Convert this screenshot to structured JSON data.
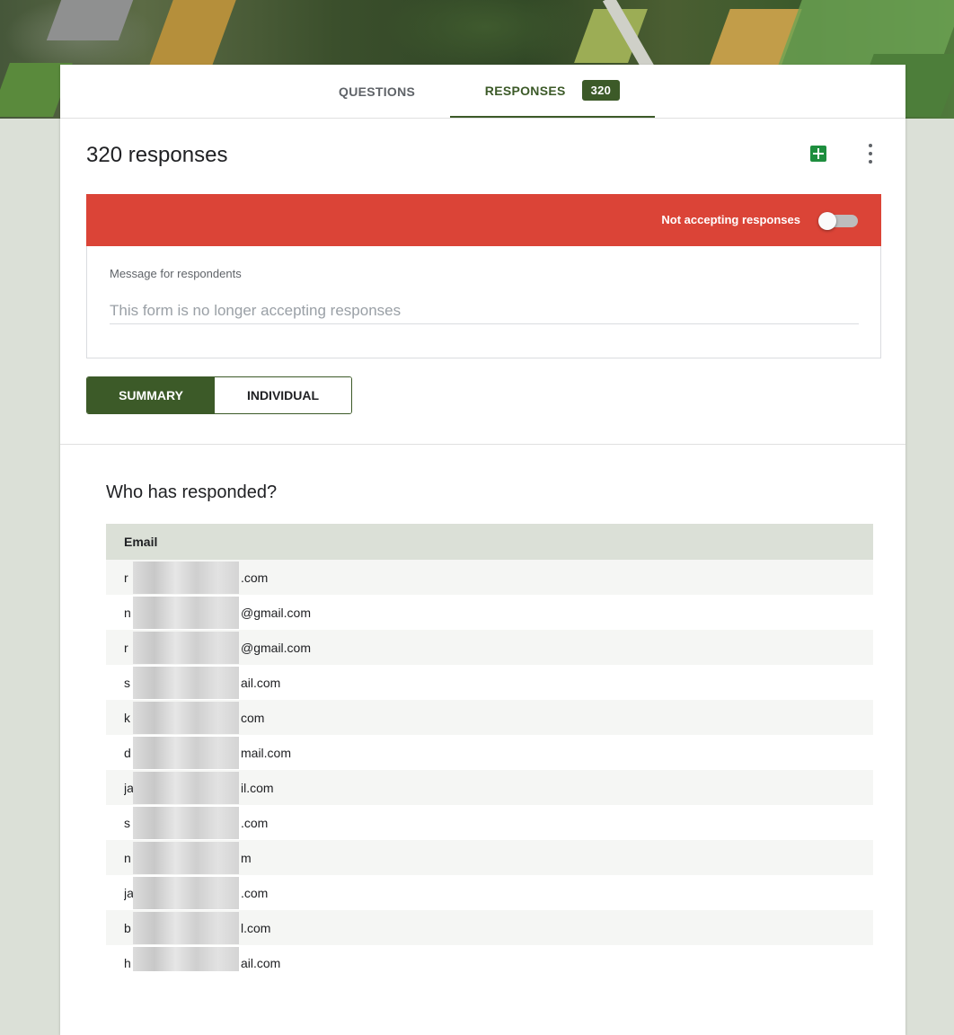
{
  "tabs": {
    "questions": "QUESTIONS",
    "responses": "RESPONSES",
    "responses_count": "320"
  },
  "header": {
    "title": "320 responses",
    "sheets_icon": "sheets-icon",
    "more_icon": "more-vert-icon"
  },
  "banner": {
    "label": "Not accepting responses",
    "accepting": false,
    "color": "#db4437"
  },
  "message": {
    "label": "Message for respondents",
    "placeholder": "This form is no longer accepting responses"
  },
  "view_toggle": {
    "summary": "SUMMARY",
    "individual": "INDIVIDUAL",
    "selected": "SUMMARY"
  },
  "respondents": {
    "title": "Who has responded?",
    "column": "Email",
    "rows": [
      {
        "pre": "r",
        "post": ".com"
      },
      {
        "pre": "n",
        "post": "@gmail.com"
      },
      {
        "pre": "r",
        "post": "@gmail.com"
      },
      {
        "pre": "s",
        "post": "ail.com"
      },
      {
        "pre": "k",
        "post": "com"
      },
      {
        "pre": "d",
        "post": "mail.com"
      },
      {
        "pre": "ja",
        "post": "il.com"
      },
      {
        "pre": "s",
        "post": ".com"
      },
      {
        "pre": "n",
        "post": "m"
      },
      {
        "pre": "ja",
        "post": ".com"
      },
      {
        "pre": "b",
        "post": "l.com"
      },
      {
        "pre": "h",
        "post": "ail.com"
      }
    ]
  },
  "colors": {
    "accent": "#3c5a28",
    "page_bg": "#dbe0d7"
  }
}
